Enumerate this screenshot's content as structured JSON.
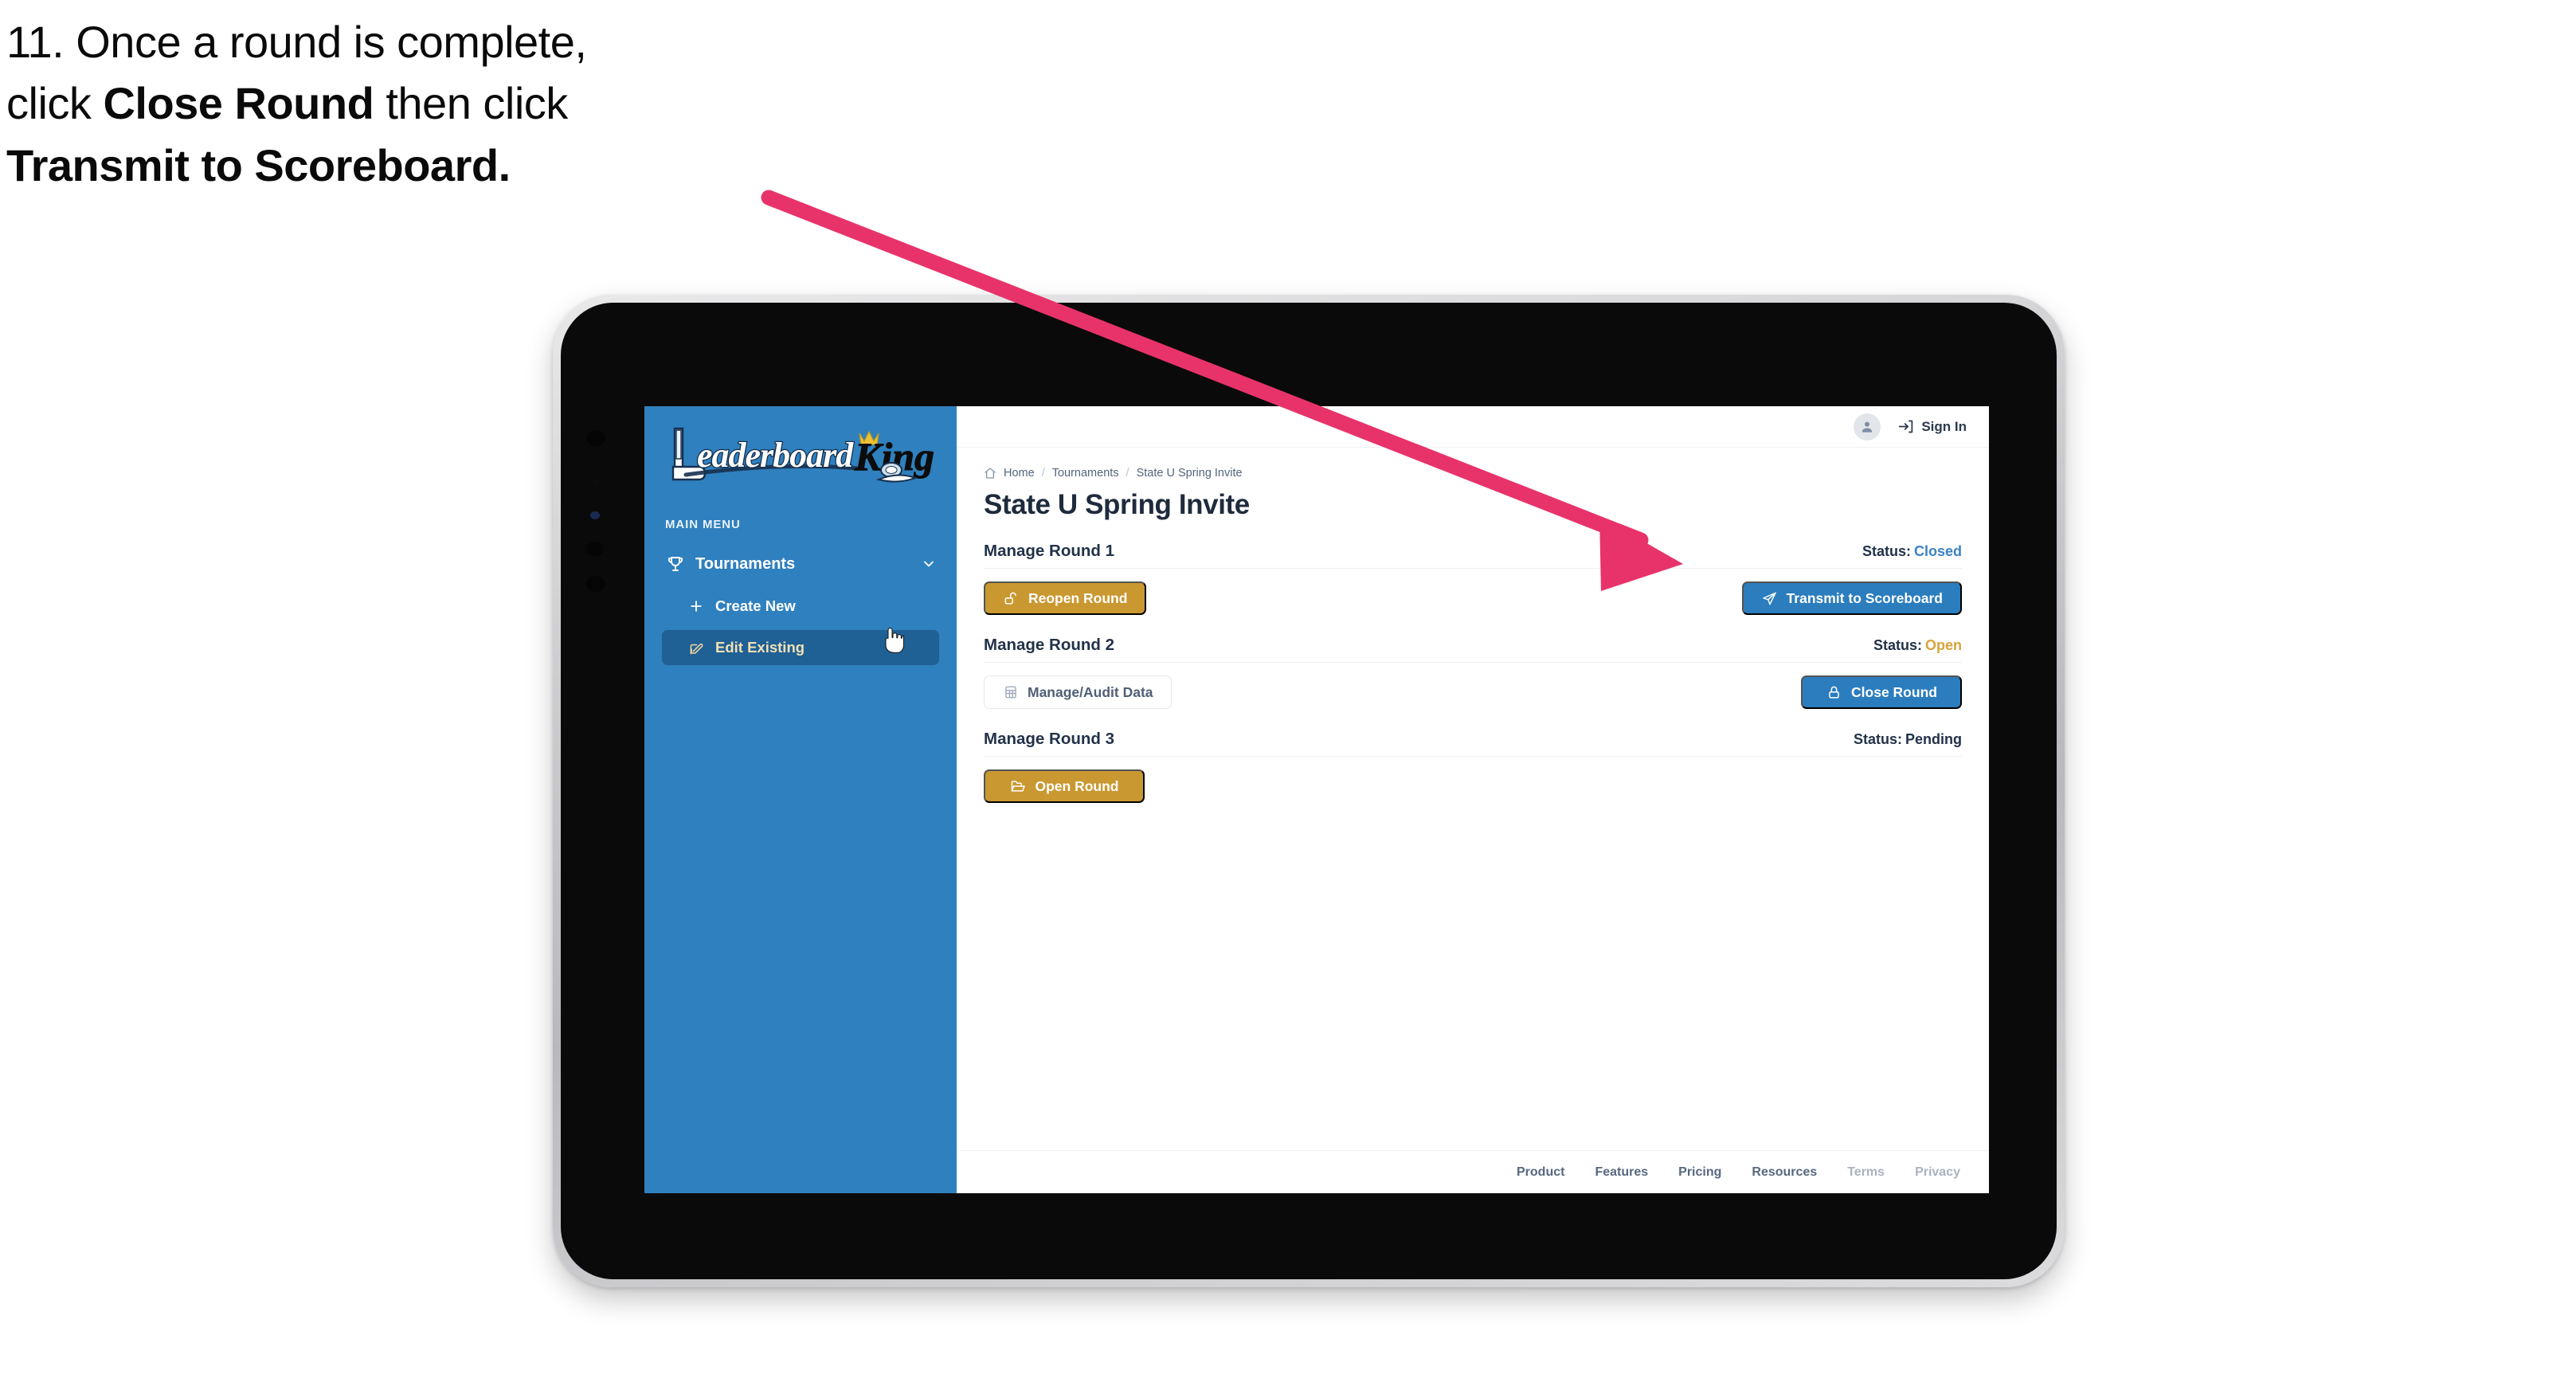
{
  "caption": {
    "line1_plain": "11. Once a round is complete,",
    "line2_plain_a": "click ",
    "line2_bold": "Close Round",
    "line2_plain_b": " then click",
    "line3_bold": "Transmit to Scoreboard."
  },
  "colors": {
    "arrow": "#E8336A",
    "sidebar_blue": "#2F80BE",
    "sidebar_active": "#1F6095",
    "gold": "#CA9830",
    "blue": "#2B7DBE",
    "status_closed": "#3B82C4",
    "status_open": "#D8A43C",
    "status_pending": "#22324A",
    "title_navy": "#1F2B3D"
  },
  "sidebar": {
    "logo_primary": "Leaderboard",
    "logo_secondary": "King",
    "section_label": "MAIN MENU",
    "nav": [
      {
        "label": "Tournaments",
        "icon": "trophy-icon",
        "chevron": "chevron-down-icon",
        "active": false
      }
    ],
    "sub_items": [
      {
        "label": "Create New",
        "icon": "plus-icon",
        "active": false
      },
      {
        "label": "Edit Existing",
        "icon": "pencil-edit-icon",
        "active": true
      }
    ]
  },
  "topbar": {
    "avatar_icon": "user-avatar-icon",
    "signin_icon": "sign-in-arrow-icon",
    "signin_label": "Sign In"
  },
  "breadcrumb": {
    "home_icon": "home-icon",
    "items": [
      "Home",
      "Tournaments",
      "State U Spring Invite"
    ],
    "separator": "/"
  },
  "page": {
    "title": "State U Spring Invite"
  },
  "rounds": [
    {
      "title": "Manage Round 1",
      "status_label": "Status:",
      "status_value": "Closed",
      "status_color": "#3B82C4",
      "left_button": {
        "label": "Reopen Round",
        "icon": "unlock-icon",
        "style": "gold"
      },
      "right_button": {
        "label": "Transmit to Scoreboard",
        "icon": "paper-plane-icon",
        "style": "blue"
      }
    },
    {
      "title": "Manage Round 2",
      "status_label": "Status:",
      "status_value": "Open",
      "status_color": "#D8A43C",
      "left_button": {
        "label": "Manage/Audit Data",
        "icon": "table-grid-icon",
        "style": "ghost"
      },
      "right_button": {
        "label": "Close Round",
        "icon": "lock-icon",
        "style": "blue"
      }
    },
    {
      "title": "Manage Round 3",
      "status_label": "Status:",
      "status_value": "Pending",
      "status_color": "#22324A",
      "left_button": {
        "label": "Open Round",
        "icon": "open-folder-icon",
        "style": "gold"
      },
      "right_button": null
    }
  ],
  "footer": {
    "links": [
      {
        "label": "Product",
        "muted": false
      },
      {
        "label": "Features",
        "muted": false
      },
      {
        "label": "Pricing",
        "muted": false
      },
      {
        "label": "Resources",
        "muted": false
      },
      {
        "label": "Terms",
        "muted": true
      },
      {
        "label": "Privacy",
        "muted": true
      }
    ]
  }
}
